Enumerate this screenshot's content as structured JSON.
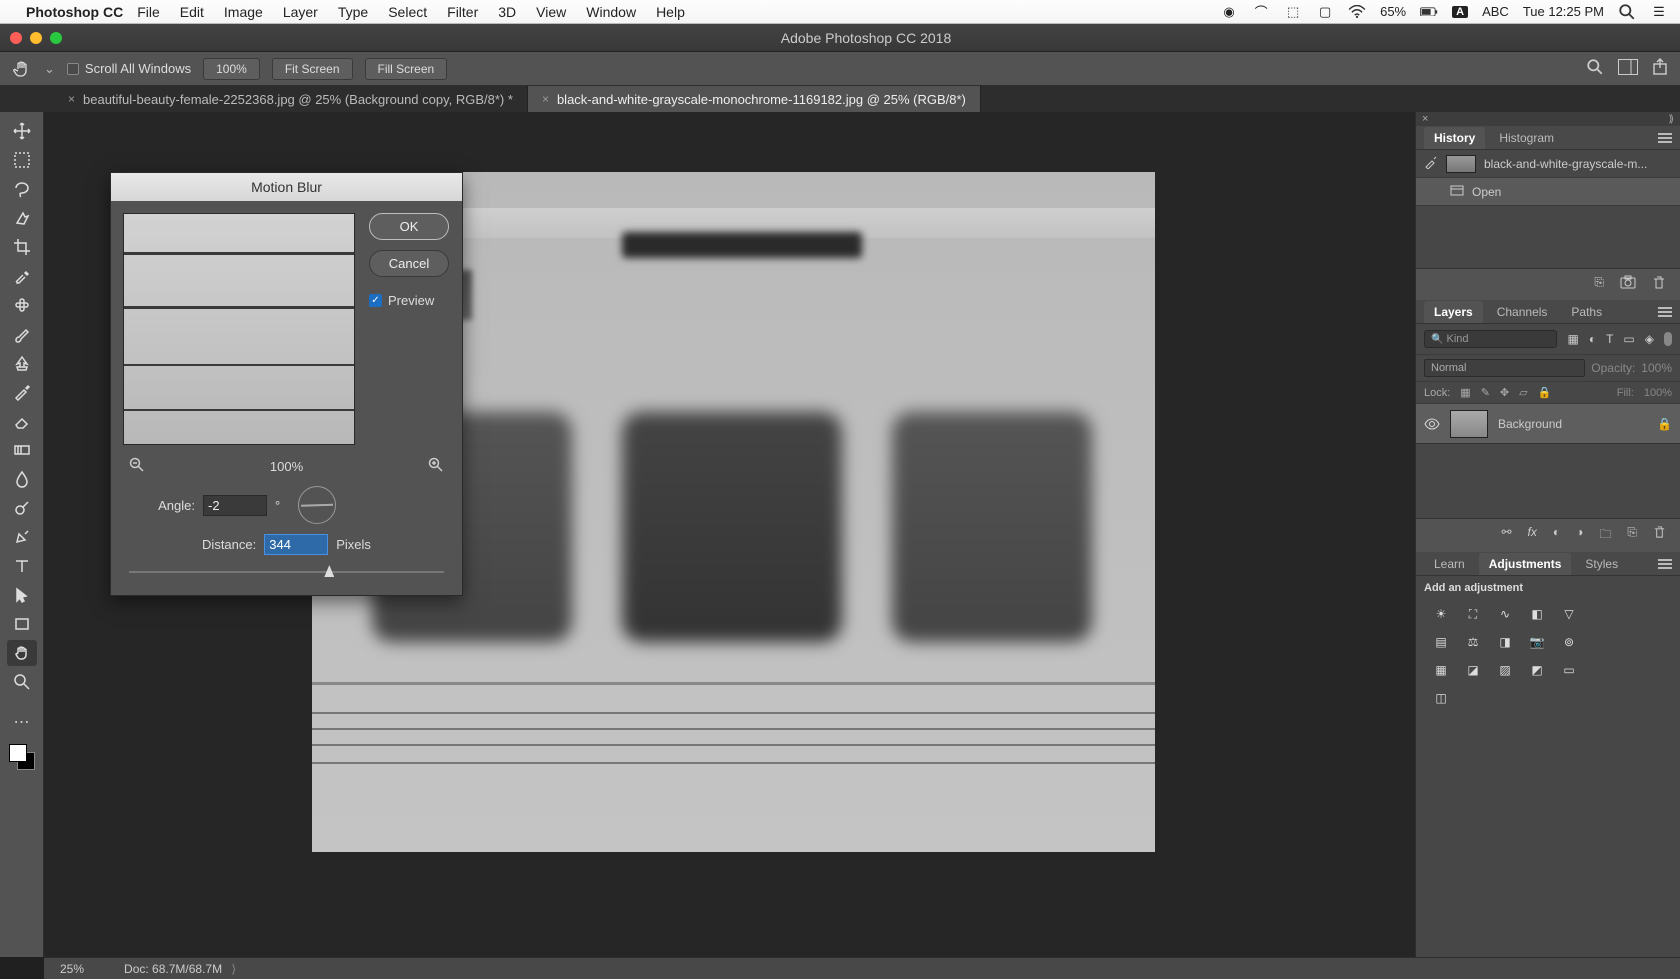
{
  "menubar": {
    "app": "Photoshop CC",
    "items": [
      "File",
      "Edit",
      "Image",
      "Layer",
      "Type",
      "Select",
      "Filter",
      "3D",
      "View",
      "Window",
      "Help"
    ],
    "battery": "65%",
    "input_mode": "A",
    "input_lang": "ABC",
    "clock": "Tue 12:25 PM"
  },
  "titlebar": {
    "title": "Adobe Photoshop CC 2018"
  },
  "optionsbar": {
    "scroll_all": "Scroll All Windows",
    "zoom": "100%",
    "fit": "Fit Screen",
    "fill": "Fill Screen"
  },
  "tabs": [
    {
      "label": "beautiful-beauty-female-2252368.jpg @ 25% (Background copy, RGB/8*) *",
      "active": false
    },
    {
      "label": "black-and-white-grayscale-monochrome-1169182.jpg @ 25% (RGB/8*)",
      "active": true
    }
  ],
  "dialog": {
    "title": "Motion Blur",
    "ok": "OK",
    "cancel": "Cancel",
    "preview_label": "Preview",
    "preview_checked": true,
    "zoom": "100%",
    "angle_label": "Angle:",
    "angle_value": "-2",
    "angle_unit": "°",
    "distance_label": "Distance:",
    "distance_value": "344",
    "distance_unit": "Pixels"
  },
  "panels": {
    "history": {
      "tabs": [
        "History",
        "Histogram"
      ],
      "doc_name": "black-and-white-grayscale-m...",
      "items": [
        "Open"
      ]
    },
    "layers": {
      "tabs": [
        "Layers",
        "Channels",
        "Paths"
      ],
      "kind_placeholder": "Kind",
      "blend_mode": "Normal",
      "opacity_label": "Opacity:",
      "opacity_value": "100%",
      "lock_label": "Lock:",
      "fill_label": "Fill:",
      "fill_value": "100%",
      "layer_name": "Background"
    },
    "adjust": {
      "tabs": [
        "Learn",
        "Adjustments",
        "Styles"
      ],
      "title": "Add an adjustment"
    }
  },
  "statusbar": {
    "zoom": "25%",
    "doc": "Doc: 68.7M/68.7M"
  }
}
